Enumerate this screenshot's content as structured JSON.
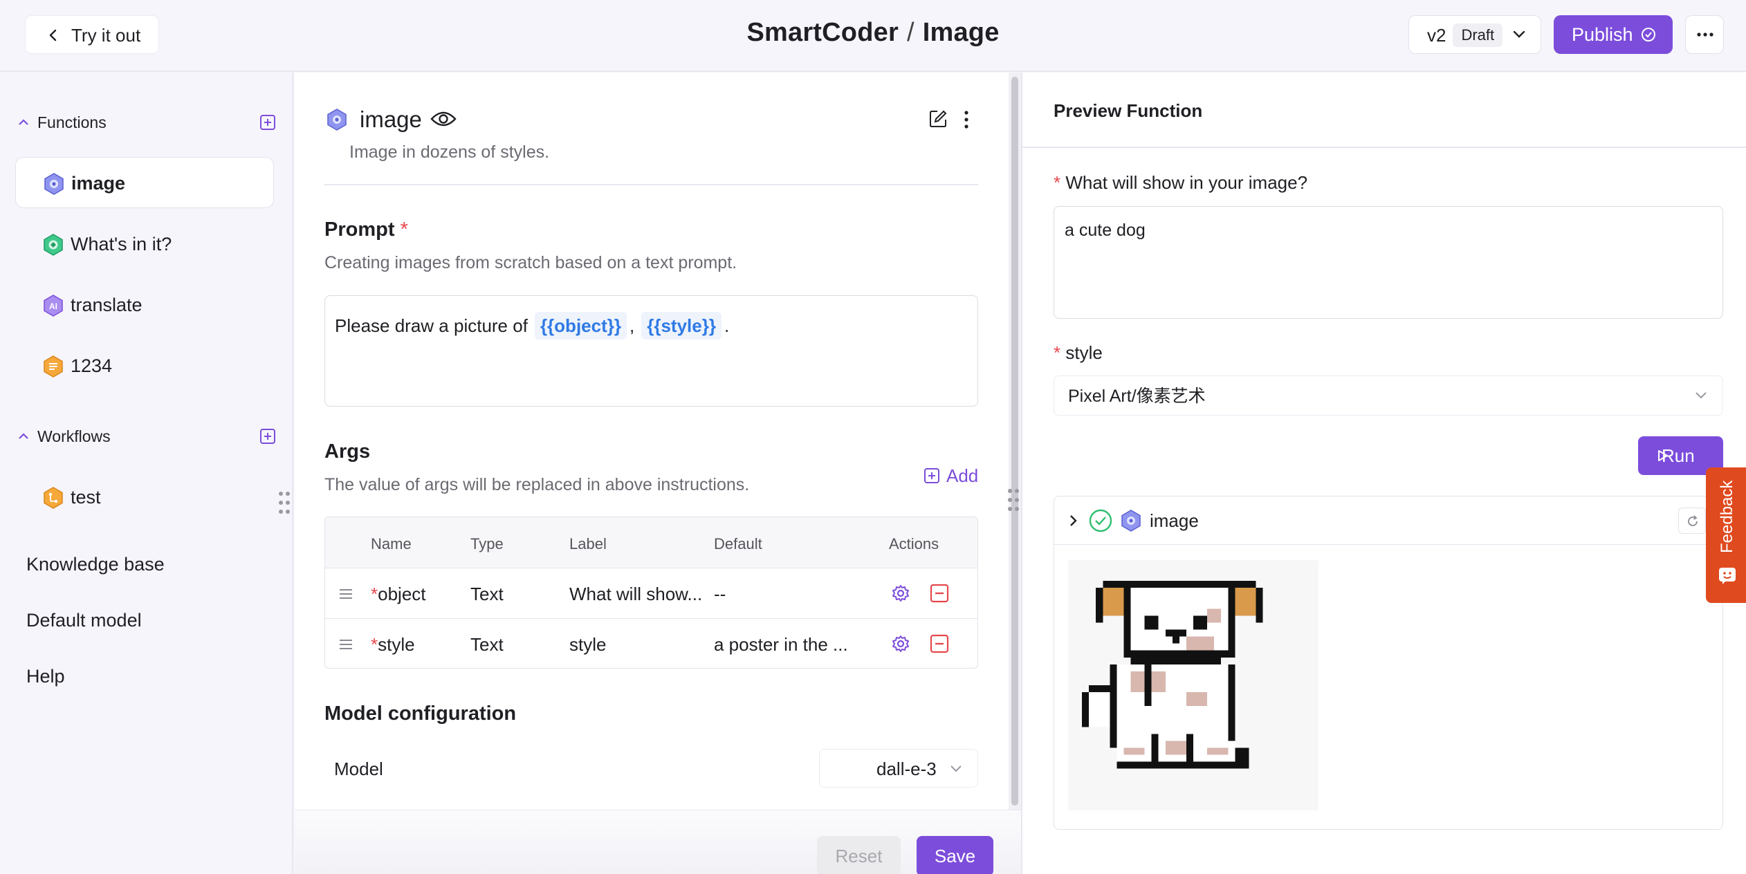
{
  "header": {
    "back_label": "Try it out",
    "app_name": "SmartCoder",
    "separator": "/",
    "page_name": "Image",
    "version": "v2",
    "version_status": "Draft",
    "publish_label": "Publish"
  },
  "sidebar": {
    "functions_label": "Functions",
    "functions": [
      {
        "label": "image",
        "icon": "image-function-icon",
        "active": true
      },
      {
        "label": "What's in it?",
        "icon": "vision-function-icon"
      },
      {
        "label": "translate",
        "icon": "ai-function-icon"
      },
      {
        "label": "1234",
        "icon": "text-function-icon"
      }
    ],
    "workflows_label": "Workflows",
    "workflows": [
      {
        "label": "test",
        "icon": "workflow-icon"
      }
    ],
    "links": [
      "Knowledge base",
      "Default model",
      "Help"
    ]
  },
  "editor": {
    "function_name": "image",
    "function_desc": "Image in dozens of styles.",
    "prompt_title": "Prompt",
    "required_mark": "*",
    "prompt_desc": "Creating images from scratch based on a text prompt.",
    "prompt_text": "Please draw a picture of",
    "prompt_token_1": "{{object}}",
    "prompt_comma": ",",
    "prompt_token_2": "{{style}}",
    "prompt_end": ".",
    "args_title": "Args",
    "args_desc": "The value of args will be replaced in above instructions.",
    "add_label": "Add",
    "table_headers": [
      "Name",
      "Type",
      "Label",
      "Default",
      "Actions"
    ],
    "args": [
      {
        "name": "object",
        "type": "Text",
        "label": "What will show...",
        "default": "--"
      },
      {
        "name": "style",
        "type": "Text",
        "label": "style",
        "default": "a poster in the ..."
      }
    ],
    "model_section_title": "Model configuration",
    "model_label": "Model",
    "model_value": "dall-e-3",
    "reset_label": "Reset",
    "save_label": "Save"
  },
  "preview": {
    "title": "Preview Function",
    "q1_label": "What will show in your image?",
    "q1_value": "a cute dog",
    "q2_label": "style",
    "q2_value": "Pixel Art/像素艺术",
    "run_label": "Run",
    "result_name": "image",
    "result_status": "success"
  },
  "feedback_label": "Feedback",
  "colors": {
    "accent": "#7c4ddb",
    "required": "#e5484d",
    "token": "#2f7ae5",
    "feedback": "#e04a1f",
    "success": "#2fbf71"
  }
}
